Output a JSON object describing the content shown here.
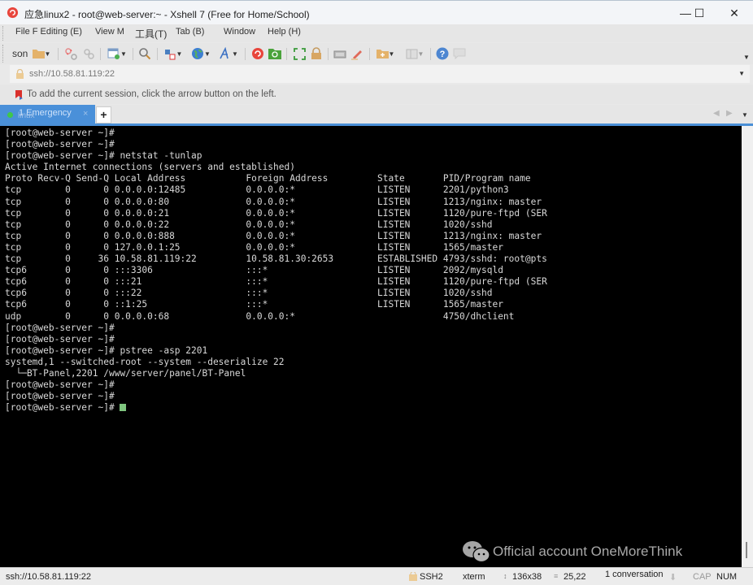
{
  "window": {
    "title": "应急linux2 - root@web-server:~ - Xshell 7 (Free for Home/School)",
    "controls": {
      "minimize": "—",
      "maximize": "☐",
      "close": "✕"
    }
  },
  "menu": [
    {
      "label": "File F Editing (E)"
    },
    {
      "label": "View M"
    },
    {
      "label": "工具(T)"
    },
    {
      "label": "Tab (B)"
    },
    {
      "label": "Window"
    },
    {
      "label": "Help (H)"
    }
  ],
  "toolbar": {
    "session_label": "son",
    "icons": [
      "folder-icon",
      "disconnect-icon",
      "link-icon",
      "settings-window-icon",
      "search-icon",
      "transfer-icon",
      "globe-icon",
      "font-icon",
      "xshell-icon",
      "xftp-icon",
      "fullscreen-icon",
      "lock-icon",
      "keyboard-icon",
      "highlight-icon",
      "new-folder-icon",
      "layout-icon",
      "help-icon",
      "chat-icon"
    ]
  },
  "address": {
    "value": "ssh://10.58.81.119:22"
  },
  "hint": {
    "text": "To add the current session, click the arrow button on the left."
  },
  "tabs": [
    {
      "label": "1 Emergency",
      "sublabel": "linux",
      "close": "×",
      "active": true
    }
  ],
  "tab_add": "+",
  "terminal": {
    "lines": [
      "[root@web-server ~]#",
      "[root@web-server ~]#",
      "[root@web-server ~]# netstat -tunlap",
      "Active Internet connections (servers and established)",
      "Proto Recv-Q Send-Q Local Address           Foreign Address         State       PID/Program name",
      "tcp        0      0 0.0.0.0:12485           0.0.0.0:*               LISTEN      2201/python3",
      "tcp        0      0 0.0.0.0:80              0.0.0.0:*               LISTEN      1213/nginx: master",
      "tcp        0      0 0.0.0.0:21              0.0.0.0:*               LISTEN      1120/pure-ftpd (SER",
      "tcp        0      0 0.0.0.0:22              0.0.0.0:*               LISTEN      1020/sshd",
      "tcp        0      0 0.0.0.0:888             0.0.0.0:*               LISTEN      1213/nginx: master",
      "tcp        0      0 127.0.0.1:25            0.0.0.0:*               LISTEN      1565/master",
      "tcp        0     36 10.58.81.119:22         10.58.81.30:2653        ESTABLISHED 4793/sshd: root@pts",
      "tcp6       0      0 :::3306                 :::*                    LISTEN      2092/mysqld",
      "tcp6       0      0 :::21                   :::*                    LISTEN      1120/pure-ftpd (SER",
      "tcp6       0      0 :::22                   :::*                    LISTEN      1020/sshd",
      "tcp6       0      0 ::1:25                  :::*                    LISTEN      1565/master",
      "udp        0      0 0.0.0.0:68              0.0.0.0:*                           4750/dhclient",
      "[root@web-server ~]#",
      "[root@web-server ~]#",
      "[root@web-server ~]# pstree -asp 2201",
      "systemd,1 --switched-root --system --deserialize 22",
      "  └─BT-Panel,2201 /www/server/panel/BT-Panel",
      "[root@web-server ~]#",
      "[root@web-server ~]#",
      "[root@web-server ~]# "
    ]
  },
  "watermark": {
    "text": "Official account OneMoreThink"
  },
  "status": {
    "address": "ssh://10.58.81.119:22",
    "protocol": "SSH2",
    "terminal_type": "xterm",
    "size": "136x38",
    "cursor": "25,22",
    "sessions": "1 conversation",
    "cap": "CAP",
    "num": "NUM"
  }
}
